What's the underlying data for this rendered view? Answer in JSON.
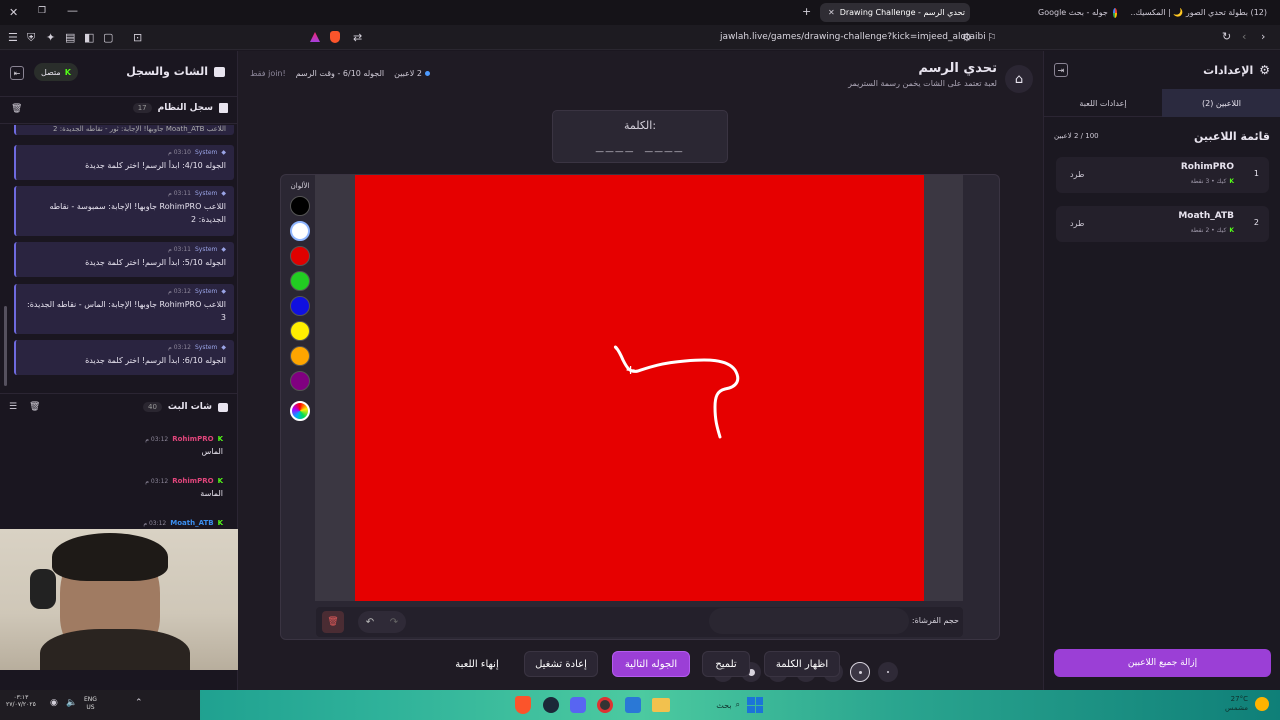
{
  "browser": {
    "tabs": [
      {
        "label": "(12) بطولة تحدي الصور 🌙 | المكسيك..."
      },
      {
        "label": "جوله - بحث Google"
      },
      {
        "label": "Drawing Challenge - تحدي الرسم"
      }
    ],
    "url": "jawlah.live/games/drawing-challenge?kick=imjeed_alotaibi"
  },
  "left": {
    "title": "الشات والسجل",
    "status": "متصل",
    "system_log": {
      "title": "سجل النظام",
      "count": "17",
      "truncated_line": "اللاعب Moath_ATB جاوبها! الإجابة: ثور - نقاطه الجديدة: 2",
      "entries": [
        {
          "sender": "System",
          "time": "03:10 م",
          "text": "الجوله 4/10: ابدأ الرسم! اختر كلمة جديدة"
        },
        {
          "sender": "System",
          "time": "03:11 م",
          "text": "اللاعب RohimPRO جاوبها! الإجابة: سمبوسة - نقاطه الجديدة: 2"
        },
        {
          "sender": "System",
          "time": "03:11 م",
          "text": "الجوله 5/10: ابدأ الرسم! اختر كلمة جديدة"
        },
        {
          "sender": "System",
          "time": "03:12 م",
          "text": "اللاعب RohimPRO جاوبها! الإجابة: الماس - نقاطه الجديدة: 3"
        },
        {
          "sender": "System",
          "time": "03:12 م",
          "text": "الجوله 6/10: ابدأ الرسم! اختر كلمة جديدة"
        }
      ]
    },
    "stream_chat": {
      "title": "شات البث",
      "count": "40",
      "messages": [
        {
          "user": "RohimPRO",
          "time": "03:12 م",
          "text": "الماس",
          "color": "#e0457b"
        },
        {
          "user": "RohimPRO",
          "time": "03:12 م",
          "text": "الماسة",
          "color": "#e0457b"
        },
        {
          "user": "Moath_ATB",
          "time": "03:12 م",
          "text": "",
          "color": "#3b8ff0"
        }
      ]
    }
  },
  "game": {
    "title": "تحدي الرسم",
    "subtitle": "لعبة تعتمد على الشات يخمن رسمة الستريمر",
    "info_players": "2 لاعبين",
    "info_round": "الجوله 6/10 - وقت الرسم",
    "info_join": "!join فقط",
    "word_label": "الكلمة:",
    "word_mask": "____ ____",
    "colors_label": "الألوان",
    "palette": [
      "#000000",
      "#ffffff",
      "#e00000",
      "#22cc22",
      "#1010e0",
      "#ffee00",
      "#ffa500",
      "#800080"
    ],
    "canvas_color": "#e60000",
    "brush_label": "حجم الفرشاة:",
    "buttons": {
      "show_word": "اظهار الكلمة",
      "hint": "تلميح",
      "next_round": "الجوله التالية",
      "replay": "إعادة تشغيل",
      "end_game": "إنهاء اللعبة"
    },
    "tools": [
      "pencil-icon",
      "eraser-icon",
      "circle-icon",
      "square-icon",
      "filled-circle-icon",
      "filled-rect-icon",
      "fill-bucket-icon",
      "line-icon"
    ]
  },
  "settings": {
    "title": "الإعدادات",
    "tabs": {
      "players": "اللاعبين (2)",
      "game": "إعدادات اللعبة"
    },
    "list_title": "قائمة اللاعبين",
    "player_count": "100 / 2 لاعبين",
    "players": [
      {
        "rank": "1",
        "name": "RohimPRO",
        "meta": "كيك • 3 نقطة",
        "kick": "طرد"
      },
      {
        "rank": "2",
        "name": "Moath_ATB",
        "meta": "كيك • 2 نقطة",
        "kick": "طرد"
      }
    ],
    "remove_all": "إزالة جميع اللاعبين"
  },
  "taskbar": {
    "search": "بحث",
    "lang": "ENG",
    "lang2": "US",
    "weather": "27°C",
    "weather_desc": "مشمس",
    "clock_time": "٠٣:١٣",
    "clock_date": "٢٧/٠٧/٢٠٢٥"
  }
}
